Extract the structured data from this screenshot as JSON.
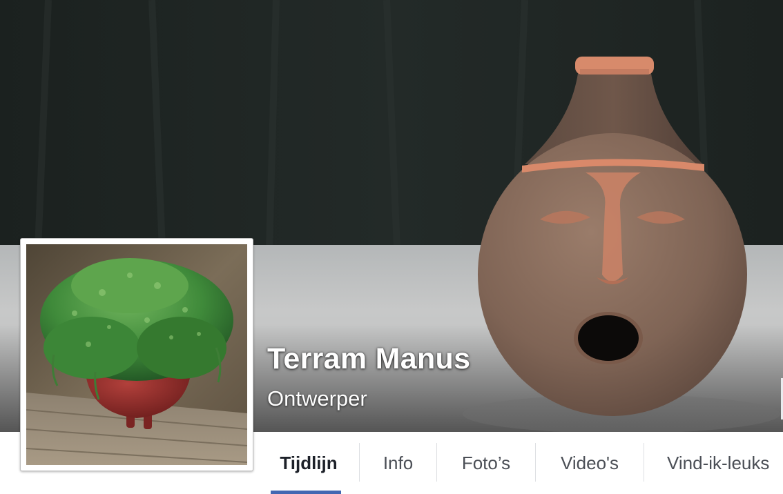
{
  "page": {
    "name": "Terram Manus",
    "category": "Ontwerper"
  },
  "cover_photo": {
    "subject": "terracotta face vase",
    "colors": {
      "backdrop": "#1f2523",
      "table": "#bfc0c0",
      "clay": "#8a6e5c",
      "clay_rim": "#d9896a"
    }
  },
  "profile_photo": {
    "subject": "potted plant in red pot on wooden table",
    "colors": {
      "foliage": "#3e8a3a",
      "pot": "#8c2a28",
      "wood": "#8f8270"
    }
  },
  "nav": {
    "tabs": [
      {
        "label": "Tijdlijn",
        "active": true
      },
      {
        "label": "Info",
        "active": false
      },
      {
        "label": "Foto’s",
        "active": false
      },
      {
        "label": "Video's",
        "active": false
      },
      {
        "label": "Vind-ik-leuks",
        "active": false
      }
    ],
    "accent_color": "#4267b2"
  }
}
